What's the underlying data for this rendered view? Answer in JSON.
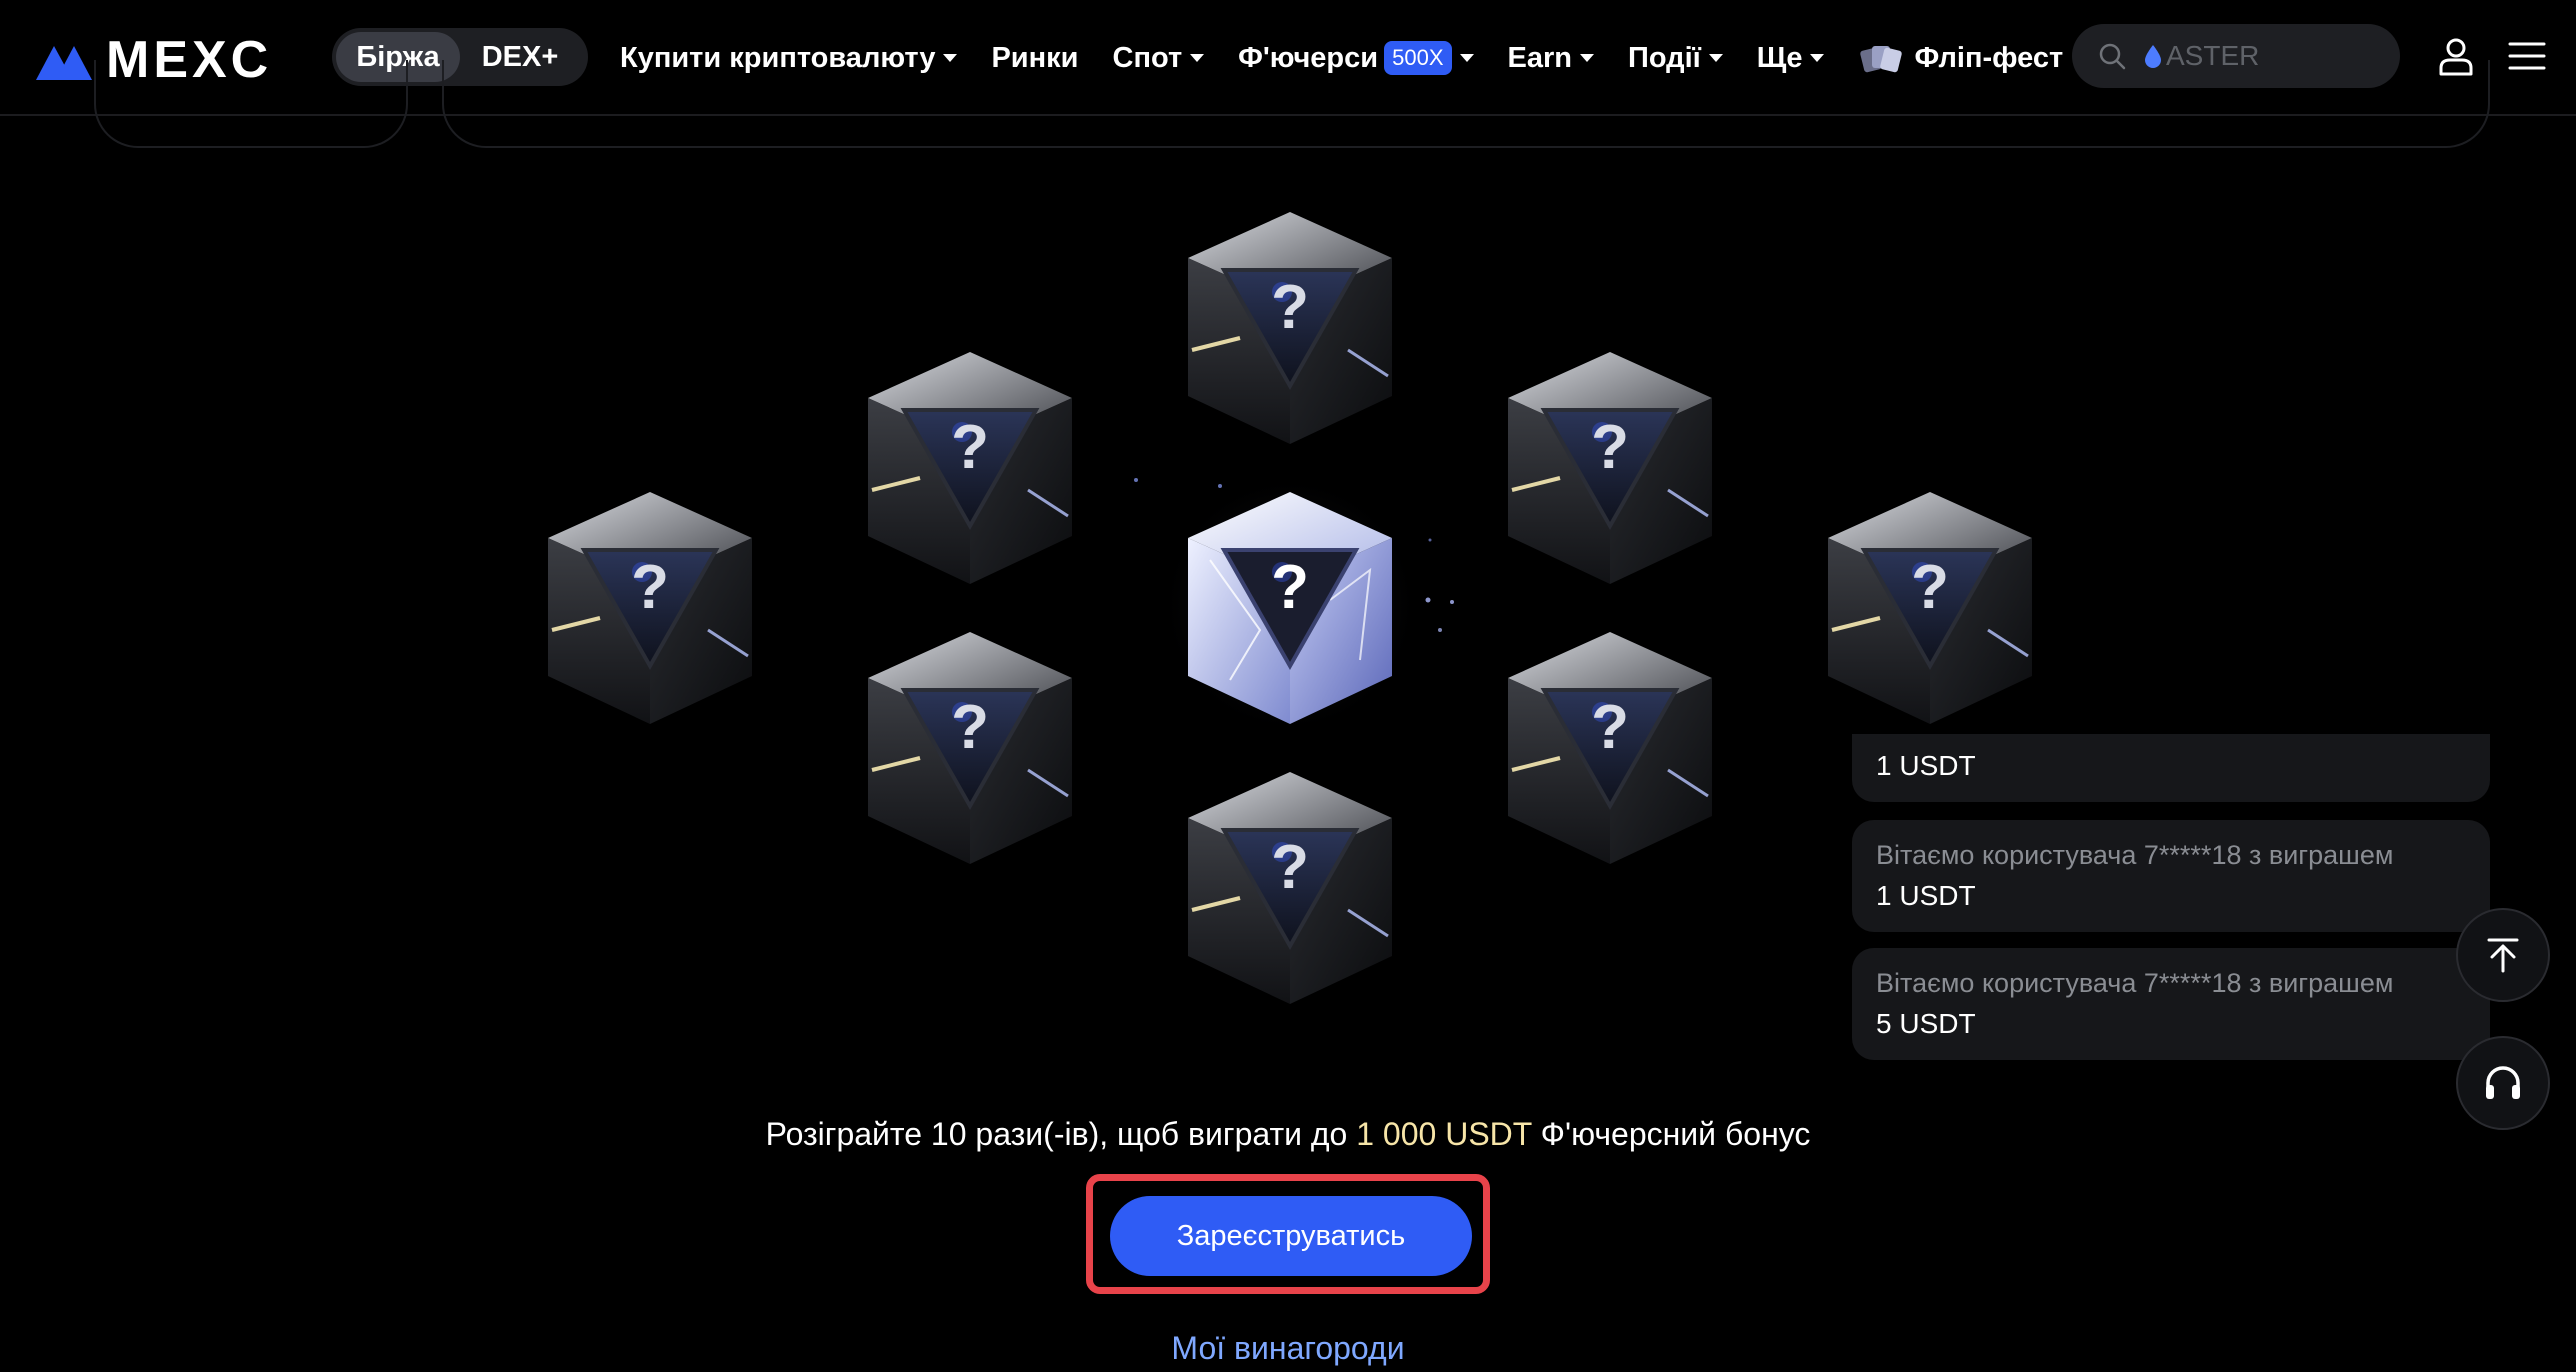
{
  "brand": {
    "name": "MEXC"
  },
  "header": {
    "segments": [
      "Біржа",
      "DEX+"
    ],
    "nav": [
      {
        "label": "Купити криптовалюту",
        "dropdown": true
      },
      {
        "label": "Ринки",
        "dropdown": false
      },
      {
        "label": "Спот",
        "dropdown": true
      },
      {
        "label": "Ф'ючерси",
        "badge": "500X",
        "dropdown": true
      },
      {
        "label": "Earn",
        "dropdown": true
      },
      {
        "label": "Події",
        "dropdown": true
      },
      {
        "label": "Ще",
        "dropdown": true
      },
      {
        "label": "Фліп-фест",
        "icon": "cards-icon",
        "dropdown": false
      }
    ],
    "search": {
      "placeholder": "ASTER"
    }
  },
  "feed": [
    {
      "line1": "",
      "line2": "1 USDT"
    },
    {
      "line1": "Вітаємо користувача 7*****18 з виграшем",
      "line2": "1 USDT"
    },
    {
      "line1": "Вітаємо користувача 7*****18 з виграшем",
      "line2": "5 USDT"
    }
  ],
  "promo": {
    "before": "Розіграйте 10 рази(-ів), щоб виграти до ",
    "highlight": "1 000 USDT",
    "after": " Ф'ючерсний бонус"
  },
  "cta": {
    "label": "Зареєструватись"
  },
  "rewards_link": "Мої винагороди",
  "boxes": {
    "count": 9,
    "mark": "?"
  },
  "colors": {
    "accent": "#2f5cf5",
    "highlight": "#f7e5a8",
    "outline": "#e8434a"
  }
}
